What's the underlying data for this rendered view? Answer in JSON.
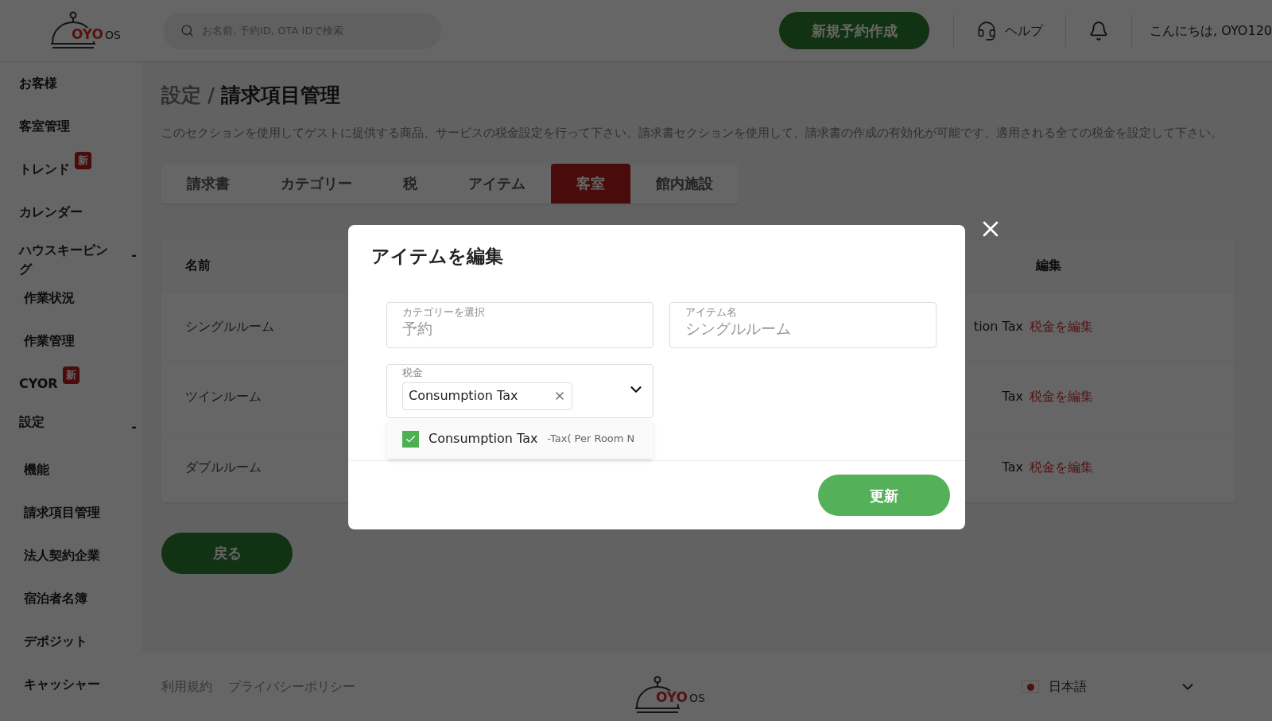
{
  "header": {
    "logo": {
      "brand": "OYO",
      "suffix": "OS"
    },
    "search": {
      "placeholder": "お名前, 予約ID, OTA IDで検索"
    },
    "new_booking_button": "新規予約作成",
    "help": "ヘルプ",
    "greeting": "こんにちは, OYO120"
  },
  "sidebar": {
    "items": [
      {
        "label": "お客様"
      },
      {
        "label": "客室管理"
      },
      {
        "label": "トレンド",
        "badge": "新"
      },
      {
        "label": "カレンダー"
      },
      {
        "label": "ハウスキーピング",
        "toggle": "-",
        "children": [
          {
            "label": "作業状況"
          },
          {
            "label": "作業管理"
          }
        ]
      },
      {
        "label": "CYOR",
        "badge": "新"
      },
      {
        "label": "設定",
        "toggle": "-",
        "children": [
          {
            "label": "機能"
          },
          {
            "label": "請求項目管理"
          },
          {
            "label": "法人契約企業"
          },
          {
            "label": "宿泊者名簿"
          },
          {
            "label": "デポジット"
          },
          {
            "label": "キャッシャー"
          }
        ]
      }
    ]
  },
  "page": {
    "breadcrumb": {
      "parent": "設定",
      "separator": "/",
      "current": "請求項目管理"
    },
    "description": "このセクションを使用してゲストに提供する商品、サービスの税金設定を行って下さい。請求書セクションを使用して、請求書の作成の有効化が可能です。適用される全ての税金を設定して下さい。",
    "tabs": [
      {
        "label": "請求書",
        "selected": false
      },
      {
        "label": "カテゴリー",
        "selected": false
      },
      {
        "label": "税",
        "selected": false
      },
      {
        "label": "アイテム",
        "selected": false
      },
      {
        "label": "客室",
        "selected": true
      },
      {
        "label": "館内施設",
        "selected": false
      }
    ],
    "table": {
      "columns": [
        "名前",
        "編集"
      ],
      "rows": [
        {
          "name": "シングルルーム",
          "column_2": "tion Tax",
          "edit": "税金を編集"
        },
        {
          "name": "ツインルーム",
          "column_2": "Tax",
          "edit": "税金を編集"
        },
        {
          "name": "ダブルルーム",
          "column_2": "Tax",
          "edit": "税金を編集"
        }
      ]
    },
    "back_button": "戻る"
  },
  "footer": {
    "links": [
      "利用規約",
      "プライバシーポリシー"
    ],
    "logo": {
      "brand": "OYO",
      "suffix": "OS"
    },
    "language": "日本語"
  },
  "modal": {
    "title": "アイテムを編集",
    "category": {
      "label": "カテゴリーを選択",
      "value": "予約"
    },
    "item_name": {
      "label": "アイテム名",
      "value": "シングルルーム"
    },
    "tax": {
      "label": "税金",
      "chips": [
        "Consumption Tax"
      ]
    },
    "options": [
      {
        "label": "Consumption Tax",
        "detail": "-Tax( Per Room N",
        "checked": true
      }
    ],
    "submit": "更新"
  }
}
